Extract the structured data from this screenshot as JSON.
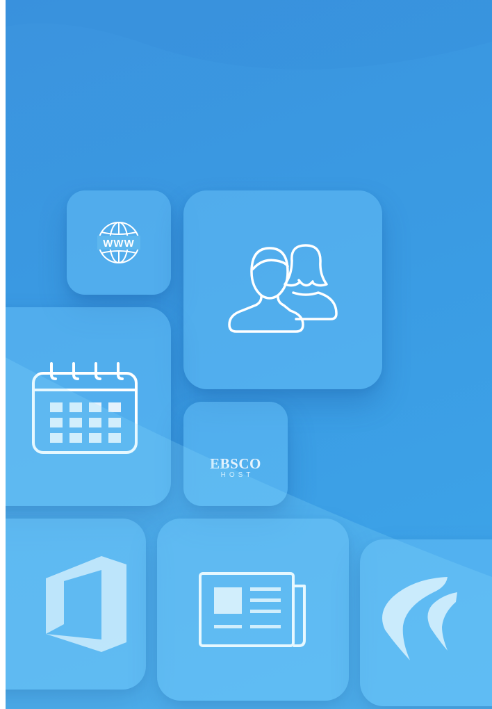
{
  "colors": {
    "background": "#3b9be3",
    "tile": "#64bef5",
    "icon_stroke": "#ffffff"
  },
  "tiles": [
    {
      "name": "web-tile",
      "icon": "www-globe-icon",
      "globe_text": "WWW"
    },
    {
      "name": "people-tile",
      "icon": "people-icon"
    },
    {
      "name": "calendar-tile",
      "icon": "calendar-icon"
    },
    {
      "name": "ebsco-tile",
      "icon": "ebsco-host-logo",
      "logo_main": "EBSCO",
      "logo_sub": "HOST"
    },
    {
      "name": "office-tile",
      "icon": "office-icon"
    },
    {
      "name": "news-tile",
      "icon": "newspaper-icon"
    },
    {
      "name": "app-tile",
      "icon": "boomerang-logo"
    }
  ]
}
